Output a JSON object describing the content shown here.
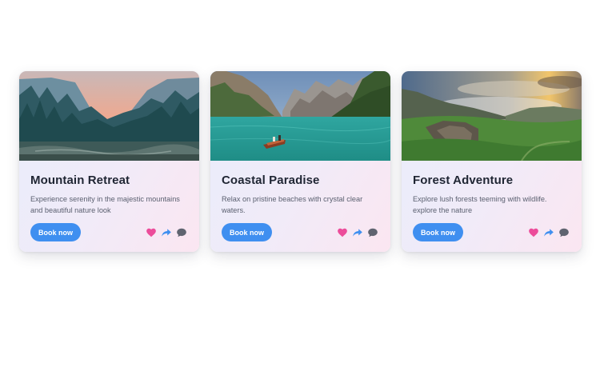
{
  "cards": [
    {
      "title": "Mountain Retreat",
      "description": "Experience serenity in the majestic mountains and beautiful nature look",
      "button_label": "Book now",
      "image": "mountain-forest-lake-photo"
    },
    {
      "title": "Coastal Paradise",
      "description": "Relax on pristine beaches with crystal clear waters.",
      "button_label": "Book now",
      "image": "turquoise-lake-boat-photo"
    },
    {
      "title": "Forest Adventure",
      "description": "Explore lush forests teeming with wildlife. explore the nature",
      "button_label": "Book now",
      "image": "green-cliffs-sunset-photo"
    }
  ],
  "actions": {
    "like_icon": "heart-icon",
    "share_icon": "share-arrow-icon",
    "comment_icon": "comment-bubble-icon"
  },
  "colors": {
    "button": "#3f8ff0",
    "heart": "#ec4c9a",
    "share": "#3f8ff0",
    "comment": "#5f6470",
    "title": "#1f2533"
  }
}
